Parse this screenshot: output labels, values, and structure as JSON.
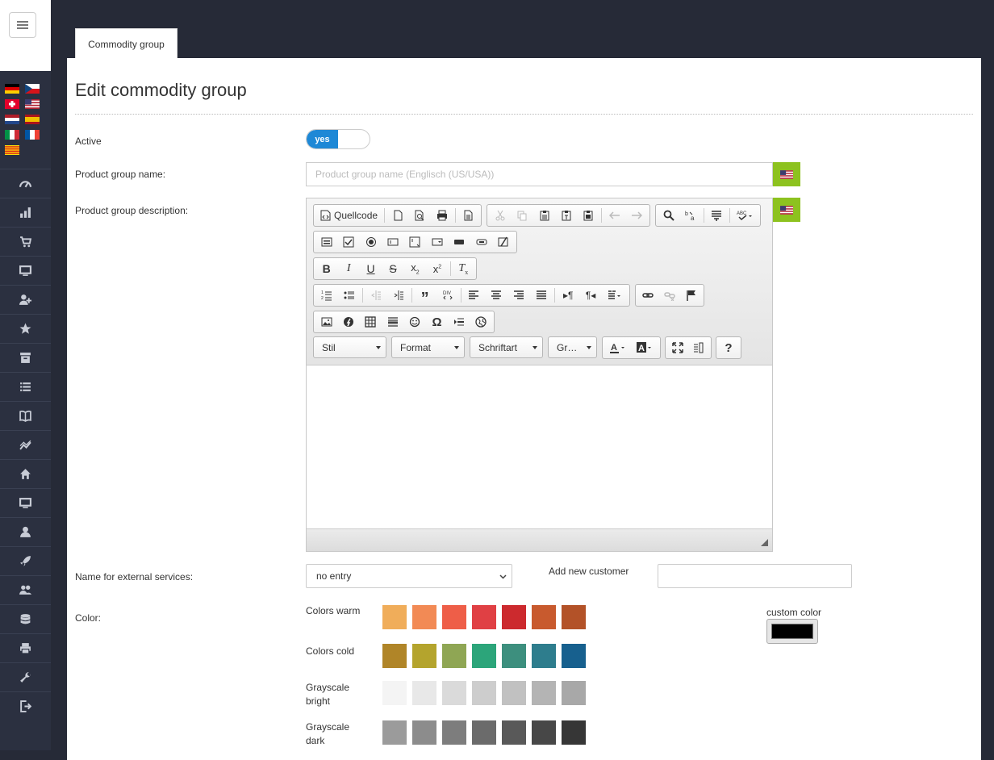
{
  "tab": {
    "label": "Commodity group"
  },
  "page": {
    "title": "Edit commodity group"
  },
  "form": {
    "active_label": "Active",
    "active_toggle": "yes",
    "name_label": "Product group name:",
    "name_placeholder": "Product group name (Englisch (US/USA))",
    "description_label": "Product group description:",
    "external_label": "Name for external services:",
    "external_value": "no entry",
    "add_customer_label": "Add new customer",
    "color_label": "Color:"
  },
  "editor": {
    "source_label": "Quellcode",
    "combos": {
      "style": "Stil",
      "format": "Format",
      "font": "Schriftart",
      "size": "Gr…"
    },
    "help": "?"
  },
  "colors": {
    "groups": [
      {
        "label": "Colors warm",
        "swatches": [
          "#f0ad5a",
          "#f28a55",
          "#ee5e48",
          "#e04044",
          "#cc2a2e",
          "#c85a2e",
          "#b35228"
        ]
      },
      {
        "label": "Colors cold",
        "swatches": [
          "#b08528",
          "#b4a42d",
          "#8fa654",
          "#2ca57a",
          "#3d8f7e",
          "#2e7d8d",
          "#17608e"
        ]
      },
      {
        "label": "Grayscale bright",
        "swatches": [
          "#f4f4f4",
          "#e8e8e8",
          "#dadada",
          "#cdcdcd",
          "#c1c1c1",
          "#b4b4b4",
          "#a8a8a8"
        ]
      },
      {
        "label": "Grayscale dark",
        "swatches": [
          "#9b9b9b",
          "#8c8c8c",
          "#7d7d7d",
          "#6b6b6b",
          "#595959",
          "#474747",
          "#363636"
        ]
      }
    ],
    "custom_label": "custom color",
    "custom_value": "#000000"
  },
  "sidebar": {
    "icons": [
      "dashboard-icon",
      "bar-chart-icon",
      "cart-icon",
      "monitor-icon",
      "add-user-icon",
      "star-icon",
      "archive-icon",
      "list-icon",
      "book-icon",
      "trend-icon",
      "home-icon",
      "display-icon",
      "user-icon",
      "rocket-icon",
      "users-icon",
      "database-icon",
      "printer-icon",
      "wrench-icon",
      "logout-icon"
    ]
  }
}
